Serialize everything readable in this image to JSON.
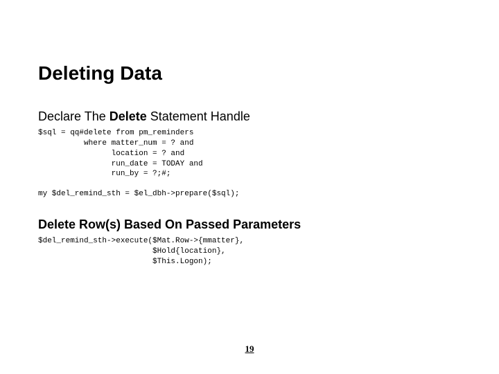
{
  "title": "Deleting Data",
  "section1": {
    "heading_pre": "Declare The ",
    "heading_bold": "Delete",
    "heading_post": " Statement Handle",
    "code1": "$sql = qq#delete from pm_reminders\n          where matter_num = ? and\n                location = ? and\n                run_date = TODAY and\n                run_by = ?;#;",
    "code2": "my $del_remind_sth = $el_dbh->prepare($sql);"
  },
  "section2": {
    "heading": "Delete Row(s) Based On Passed Parameters",
    "code": "$del_remind_sth->execute($Mat.Row->{mmatter},\n                         $Hold{location},\n                         $This.Logon);"
  },
  "page_number": "19"
}
